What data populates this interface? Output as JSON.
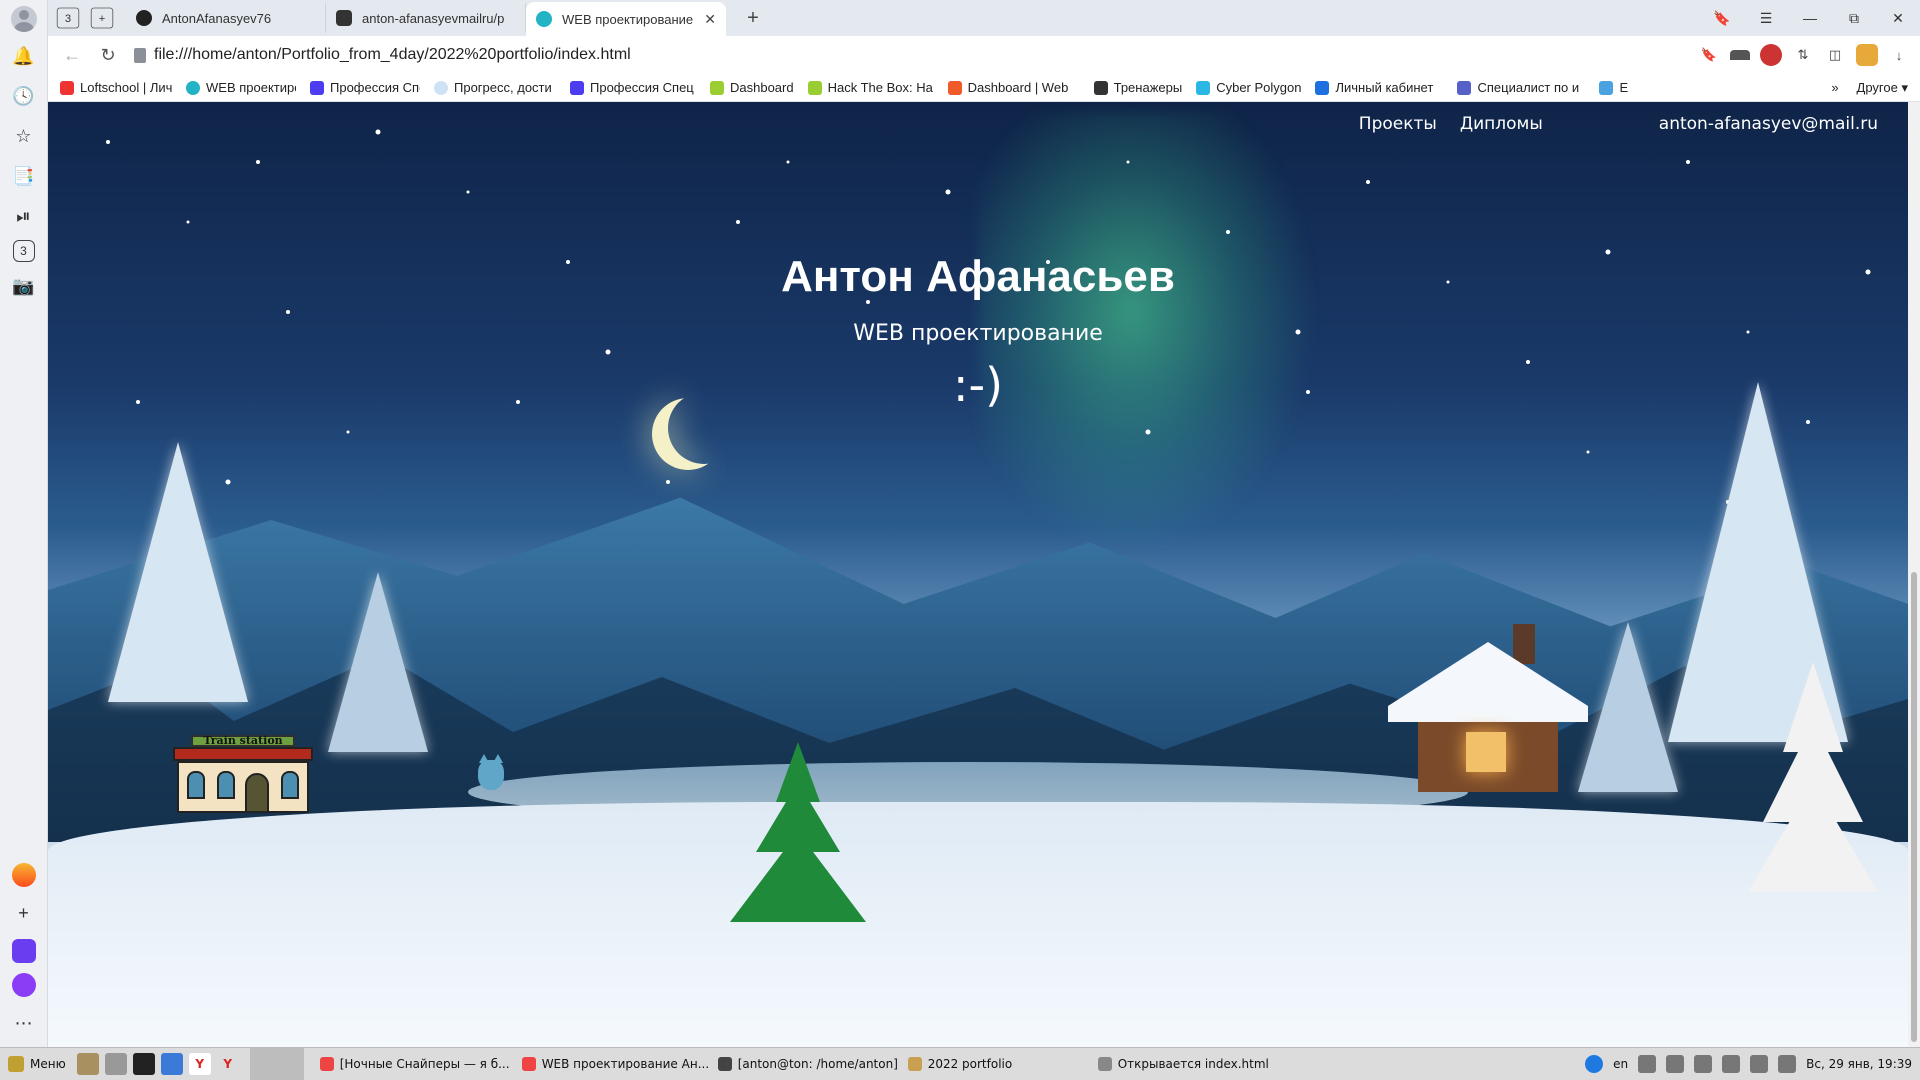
{
  "browser": {
    "tabs": [
      {
        "label": "AntonAfanasyev76",
        "active": false
      },
      {
        "label": "anton-afanasyevmailru/p",
        "active": false
      },
      {
        "label": "WEB проектирование",
        "active": true
      }
    ],
    "tab_counter": "3",
    "url": "file:///home/anton/Portfolio_from_4day/2022%20portfolio/index.html",
    "bookmarks": [
      "Loftschool | Личн",
      "WEB проектиров",
      "Профессия Спец",
      "Прогресс, дости",
      "Профессия Спец",
      "Dashboard",
      "Hack The Box: Ha",
      "Dashboard | Web",
      "Тренажеры",
      "Cyber Polygon",
      "Личный кабинет",
      "Специалист по и",
      "E"
    ],
    "bookmarks_other": "Другое",
    "sidebar_counter": "3"
  },
  "page": {
    "nav": {
      "projects": "Проекты",
      "diplomas": "Дипломы",
      "email": "anton-afanasyev@mail.ru"
    },
    "hero": {
      "title": "Антон Афанасьев",
      "subtitle": "WEB проектирование",
      "smile": ":-)"
    },
    "station_sign": "Train station"
  },
  "taskbar": {
    "menu": "Меню",
    "tasks": [
      "[Ночные Снайперы — я б...",
      "WEB проектирование Ан...",
      "[anton@ton: /home/anton]",
      "2022 portfolio",
      "Открывается index.html"
    ],
    "lang": "en",
    "clock": "Вс, 29 янв, 19:39"
  }
}
